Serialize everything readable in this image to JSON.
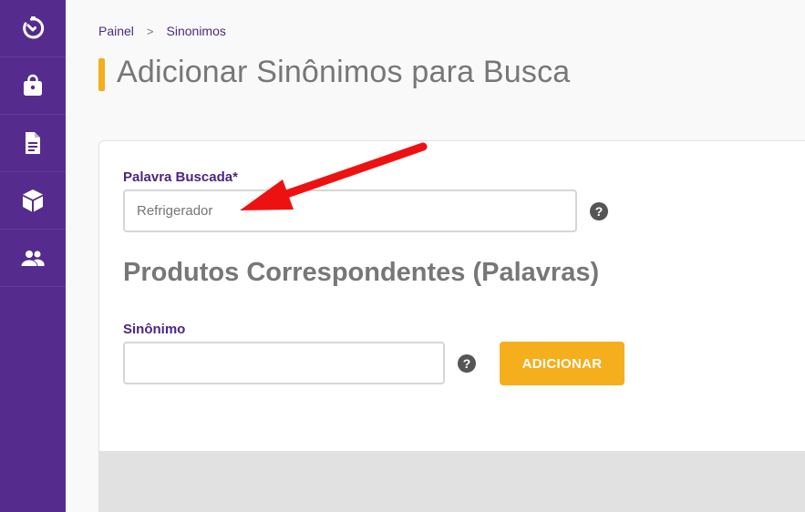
{
  "sidebar": {
    "items": [
      {
        "icon": "timer-check-icon"
      },
      {
        "icon": "shopping-bag-icon"
      },
      {
        "icon": "document-icon"
      },
      {
        "icon": "cube-icon"
      },
      {
        "icon": "users-icon"
      }
    ]
  },
  "breadcrumb": {
    "home": "Painel",
    "separator": ">",
    "current": "Sinonimos"
  },
  "page": {
    "title": "Adicionar Sinônimos para Busca"
  },
  "form": {
    "palavra_label": "Palavra Buscada*",
    "palavra_placeholder": "Refrigerador",
    "help_glyph": "?",
    "section_title": "Produtos Correspondentes (Palavras)",
    "sinonimo_label": "Sinônimo",
    "sinonimo_value": "",
    "add_button": "ADICIONAR"
  },
  "colors": {
    "sidebar": "#552c8e",
    "accent": "#f5ae1c",
    "label": "#4b2582",
    "annotation_arrow": "#ee1111"
  }
}
